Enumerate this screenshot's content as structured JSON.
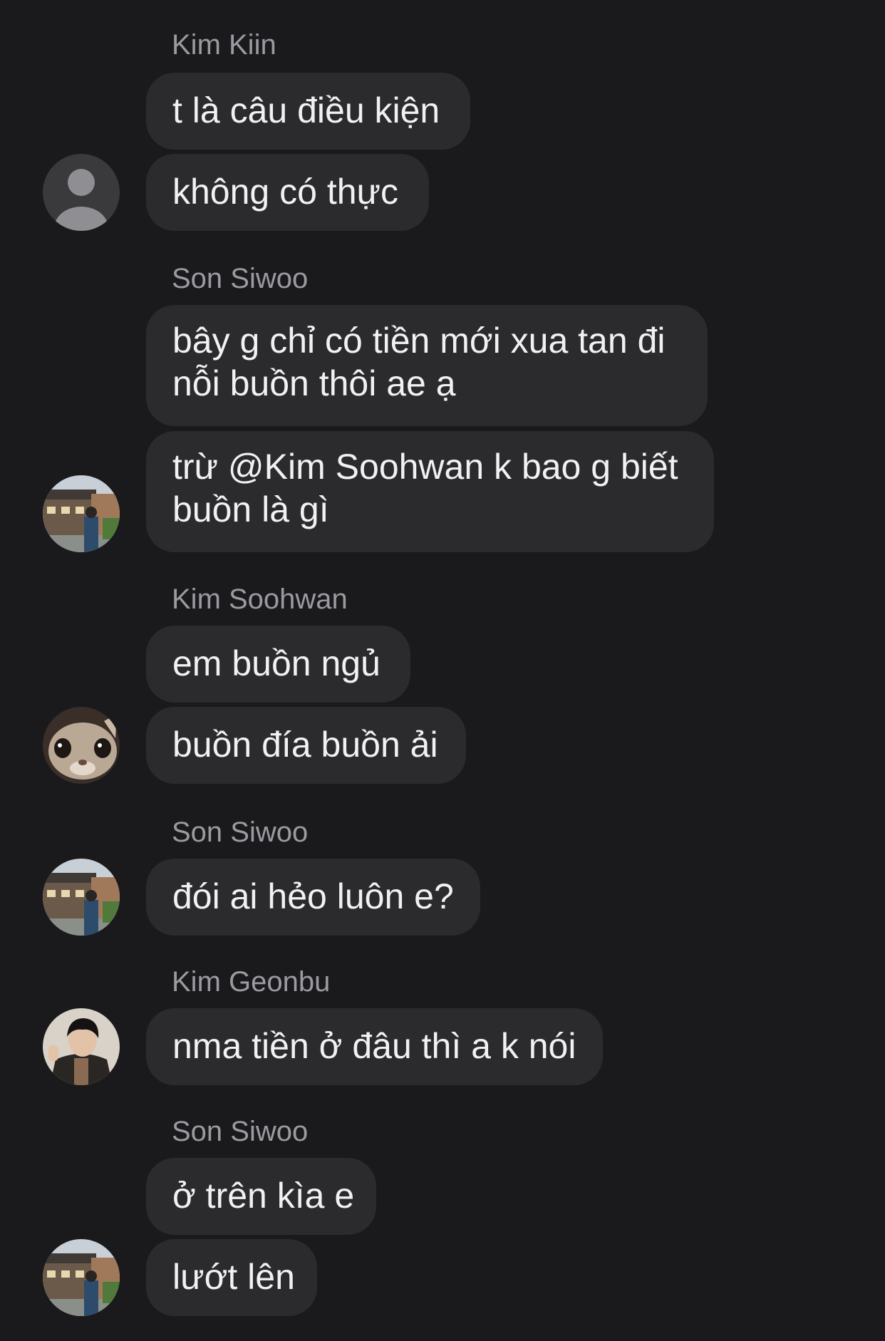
{
  "messages": [
    {
      "sender": "Kim Kiin",
      "lines": [
        "t là câu điều kiện",
        "không có thực"
      ],
      "avatar": "default-person-icon"
    },
    {
      "sender": "Son Siwoo",
      "lines": [
        "bây g chỉ có tiền mới xua tan đi nỗi buồn thôi ae ạ",
        "trừ @Kim Soohwan k bao g biết buồn là gì"
      ],
      "avatar": "building-street-photo"
    },
    {
      "sender": "Kim Soohwan",
      "lines": [
        "em buồn ngủ",
        "buồn đía buồn ải"
      ],
      "avatar": "cat-face-photo"
    },
    {
      "sender": "Son Siwoo",
      "lines": [
        "đói ai hẻo luôn e?"
      ],
      "avatar": "building-street-photo"
    },
    {
      "sender": "Kim Geonbu",
      "lines": [
        "nma tiền ở đâu thì a k nói"
      ],
      "avatar": "person-selfie-photo"
    },
    {
      "sender": "Son Siwoo",
      "lines": [
        "ở trên kìa e",
        "lướt lên"
      ],
      "avatar": "building-street-photo"
    }
  ],
  "colors": {
    "background": "#1a1a1d",
    "bubble": "#2b2b2e",
    "sender_text": "#9a9aa0",
    "message_text": "#f1f1f3"
  }
}
